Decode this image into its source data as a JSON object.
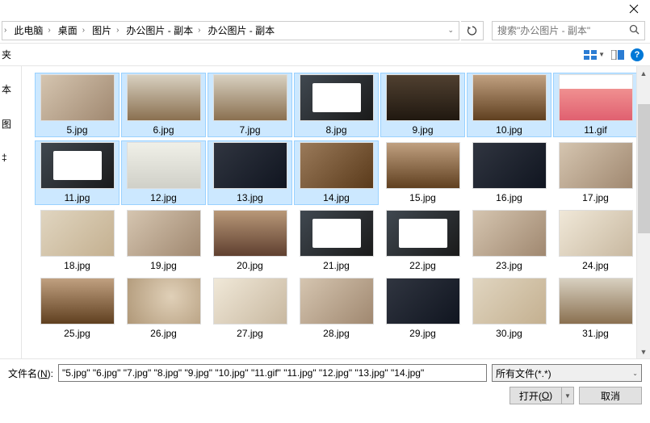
{
  "breadcrumb": {
    "items": [
      "此电脑",
      "桌面",
      "图片",
      "办公图片 - 副本",
      "办公图片 - 副本"
    ]
  },
  "search": {
    "placeholder": "搜索\"办公图片 - 副本\""
  },
  "sidebar": {
    "label0": "夹",
    "label1": "本",
    "label2": "图",
    "label3": "‡"
  },
  "files": [
    {
      "name": "5.jpg",
      "cls": "img-hands",
      "sel": true
    },
    {
      "name": "6.jpg",
      "cls": "img-office",
      "sel": true
    },
    {
      "name": "7.jpg",
      "cls": "img-office",
      "sel": true
    },
    {
      "name": "8.jpg",
      "cls": "img-screen",
      "sel": true
    },
    {
      "name": "9.jpg",
      "cls": "img-meeting",
      "sel": true
    },
    {
      "name": "10.jpg",
      "cls": "img-room",
      "sel": true
    },
    {
      "name": "11.gif",
      "cls": "img-pink",
      "sel": true
    },
    {
      "name": "11.jpg",
      "cls": "img-screen",
      "sel": true
    },
    {
      "name": "12.jpg",
      "cls": "img-gallery",
      "sel": true
    },
    {
      "name": "13.jpg",
      "cls": "img-dark",
      "sel": true
    },
    {
      "name": "14.jpg",
      "cls": "img-wood",
      "sel": true
    },
    {
      "name": "15.jpg",
      "cls": "img-room",
      "sel": false
    },
    {
      "name": "16.jpg",
      "cls": "img-dark",
      "sel": false
    },
    {
      "name": "17.jpg",
      "cls": "img-hands",
      "sel": false
    },
    {
      "name": "18.jpg",
      "cls": "img-laptop",
      "sel": false
    },
    {
      "name": "19.jpg",
      "cls": "img-hands",
      "sel": false
    },
    {
      "name": "20.jpg",
      "cls": "img-desk",
      "sel": false
    },
    {
      "name": "21.jpg",
      "cls": "img-screen",
      "sel": false
    },
    {
      "name": "22.jpg",
      "cls": "img-screen",
      "sel": false
    },
    {
      "name": "23.jpg",
      "cls": "img-hands",
      "sel": false
    },
    {
      "name": "24.jpg",
      "cls": "img-chair",
      "sel": false
    },
    {
      "name": "25.jpg",
      "cls": "img-room",
      "sel": false
    },
    {
      "name": "26.jpg",
      "cls": "img-coffee",
      "sel": false
    },
    {
      "name": "27.jpg",
      "cls": "img-chair",
      "sel": false
    },
    {
      "name": "28.jpg",
      "cls": "img-hands",
      "sel": false
    },
    {
      "name": "29.jpg",
      "cls": "img-dark",
      "sel": false
    },
    {
      "name": "30.jpg",
      "cls": "img-laptop",
      "sel": false
    },
    {
      "name": "31.jpg",
      "cls": "img-office",
      "sel": false
    }
  ],
  "footer": {
    "filename_label_pre": "文件名(",
    "filename_label_u": "N",
    "filename_label_post": "):",
    "filename_value": "\"5.jpg\" \"6.jpg\" \"7.jpg\" \"8.jpg\" \"9.jpg\" \"10.jpg\" \"11.gif\" \"11.jpg\" \"12.jpg\" \"13.jpg\" \"14.jpg\"",
    "filetype": "所有文件(*.*)",
    "open_pre": "打开(",
    "open_u": "O",
    "open_post": ")",
    "cancel": "取消"
  }
}
